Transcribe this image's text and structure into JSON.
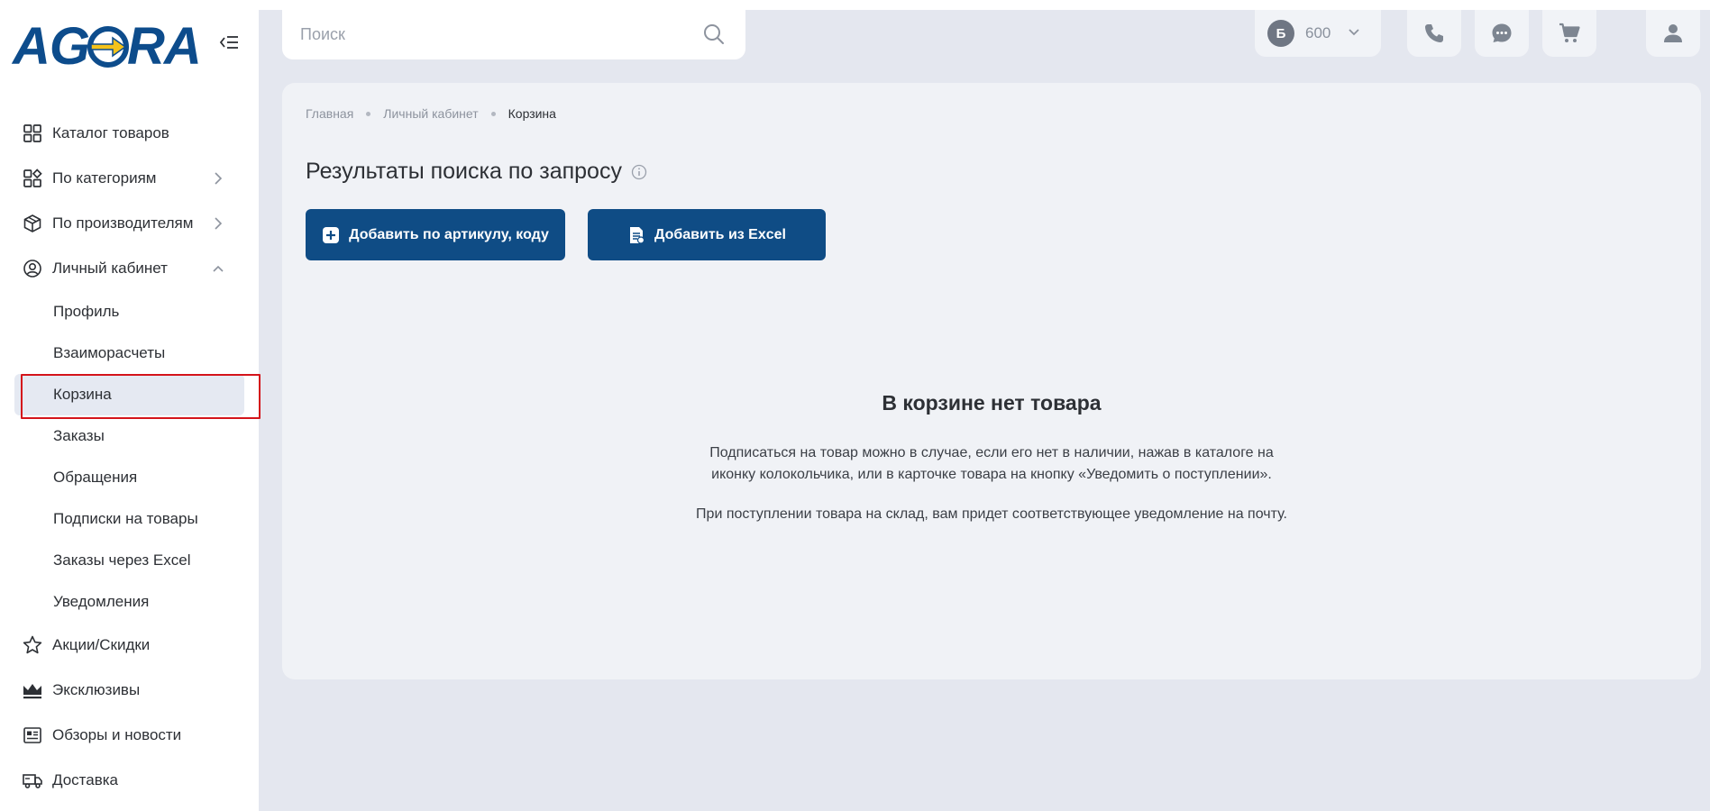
{
  "brand": {
    "logo_text_left": "A",
    "logo_text_mid": "G",
    "logo_text_right": "RA"
  },
  "colors": {
    "brand_blue": "#0f4c85",
    "logo_yellow": "#f4c21a",
    "highlight_red": "#d4141b"
  },
  "search": {
    "placeholder": "Поиск"
  },
  "header": {
    "balance_badge": "Б",
    "balance_amount": "600"
  },
  "sidebar": {
    "items": [
      {
        "label": "Каталог товаров"
      },
      {
        "label": "По категориям"
      },
      {
        "label": "По производителям"
      },
      {
        "label": "Личный кабинет"
      }
    ],
    "sub_items": [
      {
        "label": "Профиль"
      },
      {
        "label": "Взаиморасчеты"
      },
      {
        "label": "Корзина"
      },
      {
        "label": "Заказы"
      },
      {
        "label": "Обращения"
      },
      {
        "label": "Подписки на товары"
      },
      {
        "label": "Заказы через Excel"
      },
      {
        "label": "Уведомления"
      }
    ],
    "bottom_items": [
      {
        "label": "Акции/Скидки"
      },
      {
        "label": "Эксклюзивы"
      },
      {
        "label": "Обзоры и новости"
      },
      {
        "label": "Доставка"
      }
    ]
  },
  "breadcrumb": {
    "home": "Главная",
    "account": "Личный кабинет",
    "current": "Корзина"
  },
  "main": {
    "title": "Результаты поиска по запросу",
    "add_by_code_label": "Добавить по артикулу, коду",
    "add_from_excel_label": "Добавить из Excel",
    "empty_title": "В корзине нет товара",
    "empty_line1": "Подписаться на товар можно в случае, если его нет в наличии, нажав в каталоге на",
    "empty_line2": "иконку колокольчика, или в карточке товара на кнопку «Уведомить о поступлении».",
    "empty_line3": "При поступлении товара на склад, вам придет соответствующее уведомление на почту."
  }
}
